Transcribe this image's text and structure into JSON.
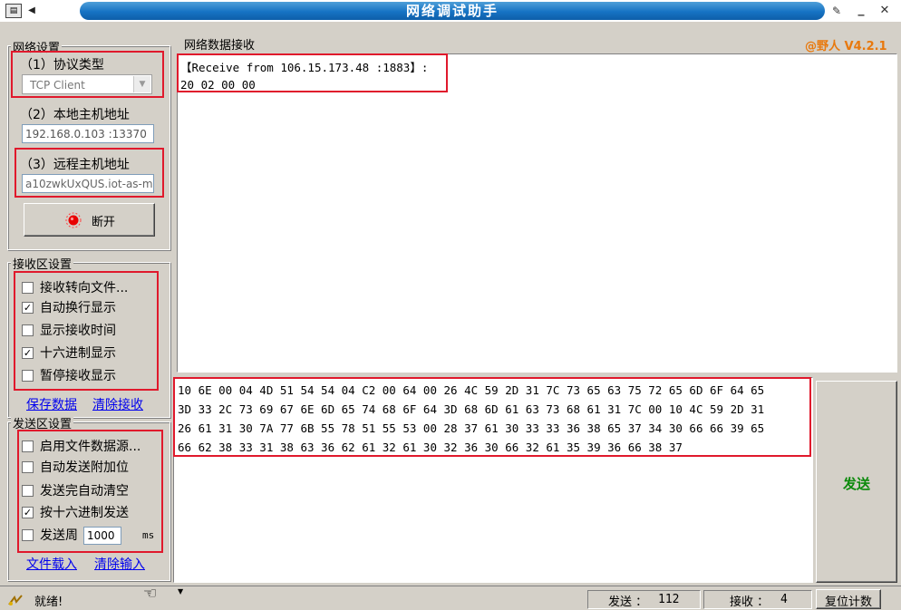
{
  "window": {
    "title": "网络调试助手",
    "app_icon": "app-window-icon",
    "controls": [
      "pin-icon",
      "minimize-icon",
      "close-icon"
    ]
  },
  "network_settings": {
    "legend": "网络设置",
    "protocol_label": "（1）协议类型",
    "protocol_value": "TCP Client",
    "local_label": "（2）本地主机地址",
    "local_value": "192.168.0.103 :13370",
    "remote_label": "（3）远程主机地址",
    "remote_value": "a10zwkUxQUS.iot-as-m",
    "disconnect_label": "断开"
  },
  "receive_settings": {
    "legend": "接收区设置",
    "options": [
      {
        "label": "接收转向文件...",
        "checked": false
      },
      {
        "label": "自动换行显示",
        "checked": true
      },
      {
        "label": "显示接收时间",
        "checked": false
      },
      {
        "label": "十六进制显示",
        "checked": true
      },
      {
        "label": "暂停接收显示",
        "checked": false
      }
    ],
    "save_link": "保存数据",
    "clear_link": "清除接收"
  },
  "send_settings": {
    "legend": "发送区设置",
    "options": [
      {
        "label": "启用文件数据源...",
        "checked": false
      },
      {
        "label": "自动发送附加位",
        "checked": false
      },
      {
        "label": "发送完自动清空",
        "checked": false
      },
      {
        "label": "按十六进制发送",
        "checked": true
      },
      {
        "label": "发送周",
        "checked": false
      }
    ],
    "period_value": "1000",
    "period_unit": "ms",
    "load_link": "文件载入",
    "clear_link": "清除输入"
  },
  "receive_area": {
    "legend": "网络数据接收",
    "version": "@野人 V4.2.1",
    "lines": [
      "【Receive from 106.15.173.48 :1883】:",
      "20 02 00 00"
    ]
  },
  "send_area": {
    "lines": [
      "10 6E 00 04 4D 51 54 54 04 C2 00 64 00 26 4C 59 2D 31 7C 73 65 63 75 72 65 6D 6F 64 65",
      "3D 33 2C 73 69 67 6E 6D 65 74 68 6F 64 3D 68 6D 61 63 73 68 61 31 7C 00 10 4C 59 2D 31",
      "26 61 31 30 7A 77 6B 55 78 51 55 53 00 28 37 61 30 33 33 36 38 65 37 34 30 66 66 39 65",
      "66 62 38 33 31 38 63 36 62 61 32 61 30 32 36 30 66 32 61 35 39 36 66 38 37"
    ],
    "send_button": "发送"
  },
  "status_bar": {
    "status": "就绪!",
    "sent_label": "发送 ：",
    "sent_count": "112",
    "recv_label": "接收 ：",
    "recv_count": "4",
    "reset_button": "复位计数"
  },
  "colors": {
    "title_blue": "#1673c4",
    "highlight_red": "#e0192c",
    "version_orange": "#e8780c",
    "send_green": "#0c8a0c",
    "link_blue": "#0000ee"
  }
}
